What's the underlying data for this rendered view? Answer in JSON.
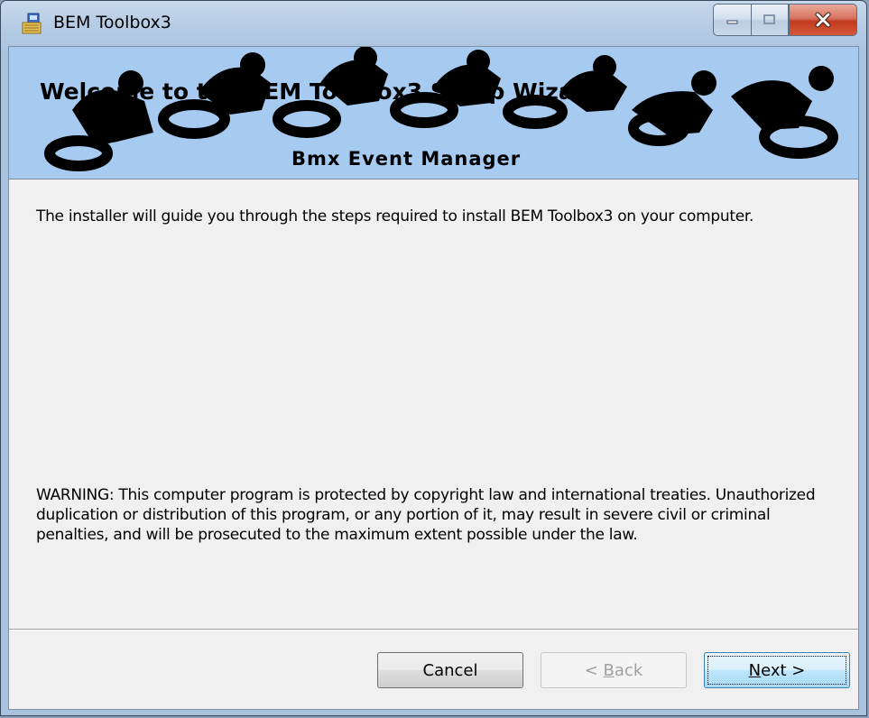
{
  "window": {
    "title": "BEM Toolbox3",
    "icon": "installer-icon"
  },
  "banner": {
    "title": "Welcome to the BEM Toolbox3 Setup Wizard",
    "subtitle": "Bmx Event Manager"
  },
  "body": {
    "intro": "The installer will guide you through the steps required to install BEM Toolbox3 on your computer.",
    "warning": "WARNING: This computer program is protected by copyright law and international treaties. Unauthorized duplication or distribution of this program, or any portion of it, may result in severe civil or criminal penalties, and will be prosecuted to the maximum extent possible under the law."
  },
  "buttons": {
    "cancel": "Cancel",
    "back_prefix": "< ",
    "back_access": "B",
    "back_rest": "ack",
    "next_access": "N",
    "next_rest": "ext >"
  },
  "colors": {
    "banner_bg": "#a6caf0",
    "dialog_bg": "#f0f0f0",
    "close_button": "#c13a1e"
  }
}
